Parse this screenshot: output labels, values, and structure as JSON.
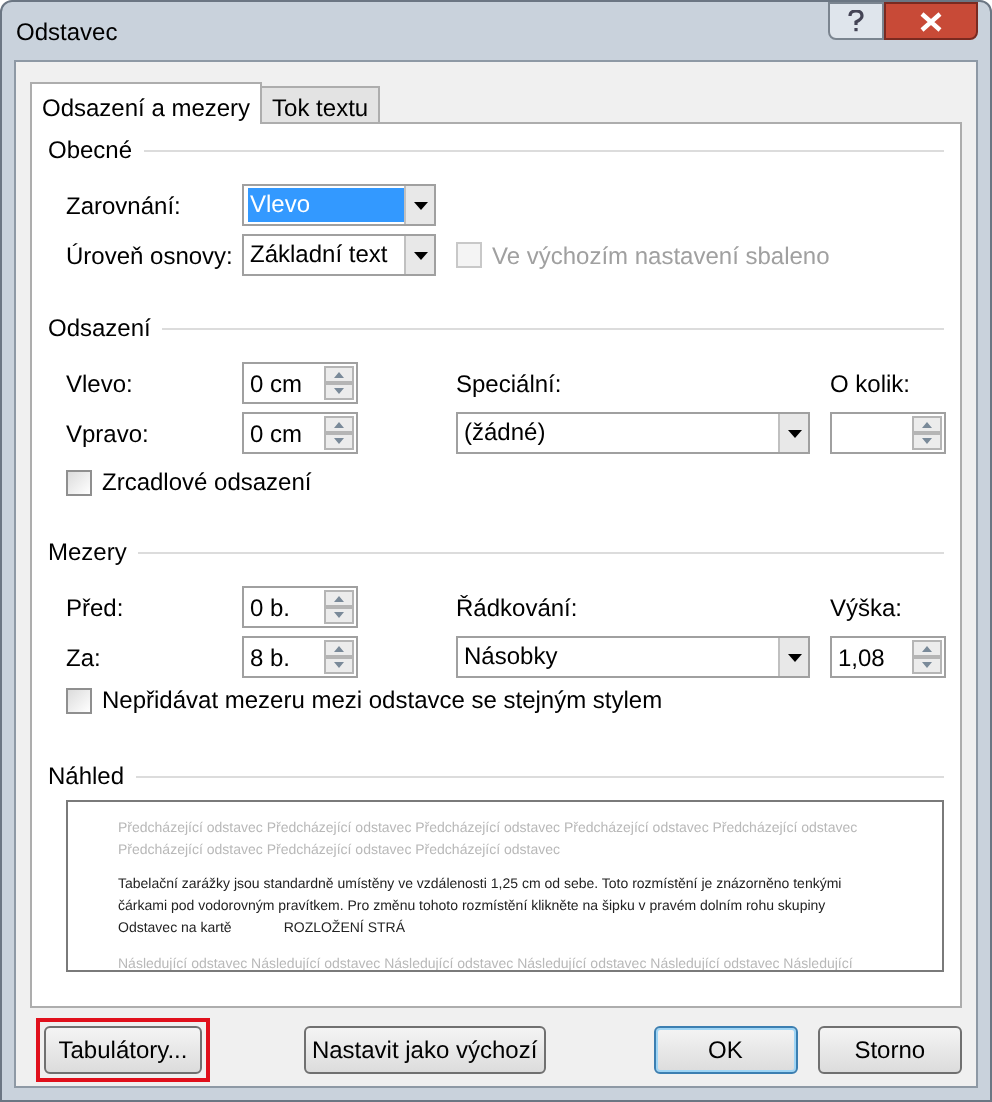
{
  "window": {
    "title": "Odstavec"
  },
  "tabs": [
    {
      "label": "Odsazení a mezery",
      "selected": true
    },
    {
      "label": "Tok textu",
      "selected": false
    }
  ],
  "general": {
    "heading": "Obecné",
    "alignment": {
      "label": "Zarovnání:",
      "value": "Vlevo",
      "highlighted": true
    },
    "outline_level": {
      "label": "Úroveň osnovy:",
      "value": "Základní text",
      "highlighted": false
    },
    "collapsed": {
      "label": "Ve výchozím nastavení sbaleno",
      "checked": false,
      "disabled": true
    }
  },
  "indentation": {
    "heading": "Odsazení",
    "left": {
      "label": "Vlevo:",
      "value": "0 cm"
    },
    "right": {
      "label": "Vpravo:",
      "value": "0 cm"
    },
    "special": {
      "label": "Speciální:",
      "value": "(žádné)"
    },
    "by": {
      "label": "O kolik:"
    },
    "mirror": {
      "label": "Zrcadlové odsazení",
      "checked": false,
      "disabled": false
    }
  },
  "spacing": {
    "heading": "Mezery",
    "before": {
      "label": "Před:",
      "value": "0 b."
    },
    "after": {
      "label": "Za:",
      "value": "8 b."
    },
    "line_spacing": {
      "label": "Řádkování:",
      "value": "Násobky"
    },
    "at": {
      "label": "Výška:",
      "value": "1,08"
    },
    "dont_add": {
      "label": "Nepřidávat mezeru mezi odstavce se stejným stylem",
      "checked": false,
      "disabled": false
    }
  },
  "preview": {
    "heading": "Náhled",
    "previous_lines": [
      "Předcházející odstavec Předcházející odstavec Předcházející odstavec Předcházející odstavec Předcházející odstavec",
      "Předcházející odstavec Předcházející odstavec Předcházející odstavec"
    ],
    "current_lines": [
      "Tabelační zarážky jsou standardně umístěny ve vzdálenosti 1,25 cm od sebe. Toto rozmístění je znázorněno tenkými",
      "čárkami pod vodorovným pravítkem. Pro změnu tohoto rozmístění klikněte na šipku v pravém dolním rohu skupiny"
    ],
    "current_last": [
      "Odstavec na kartě",
      "ROZLOŽENÍ STRÁ"
    ],
    "next_lines": [
      "Následující odstavec Následující odstavec Následující odstavec Následující odstavec Následující odstavec Následující"
    ]
  },
  "buttons": [
    {
      "label": "Tabulátory...",
      "default": false,
      "highlighted": true
    },
    {
      "label": "Nastavit jako výchozí",
      "default": false
    },
    {
      "label": "OK",
      "default": true
    },
    {
      "label": "Storno",
      "default": false
    }
  ]
}
